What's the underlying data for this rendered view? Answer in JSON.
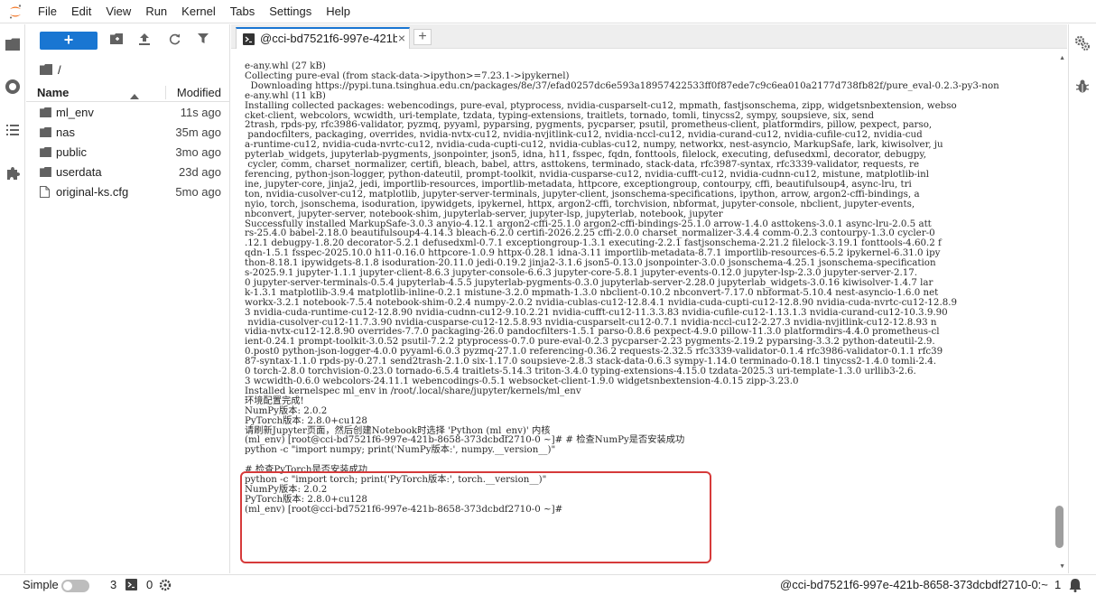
{
  "menubar": {
    "logo_icon": "jupyter-logo-icon",
    "items": [
      "File",
      "Edit",
      "View",
      "Run",
      "Kernel",
      "Tabs",
      "Settings",
      "Help"
    ]
  },
  "activitybar": {
    "icons": [
      "folder-icon",
      "running-icon",
      "toc-icon",
      "extension-icon"
    ]
  },
  "filebrowser": {
    "new_button_label": "+",
    "toolbar_icons": [
      "new-folder-icon",
      "upload-icon",
      "refresh-icon",
      "filter-icon"
    ],
    "breadcrumb": "/",
    "header_name": "Name",
    "header_modified": "Modified",
    "files": [
      {
        "name": "ml_env",
        "modified": "11s ago",
        "type": "folder"
      },
      {
        "name": "nas",
        "modified": "35m ago",
        "type": "folder"
      },
      {
        "name": "public",
        "modified": "3mo ago",
        "type": "folder"
      },
      {
        "name": "userdata",
        "modified": "23d ago",
        "type": "folder"
      },
      {
        "name": "original-ks.cfg",
        "modified": "5mo ago",
        "type": "file"
      }
    ]
  },
  "tabs": [
    {
      "label": "@cci-bd7521f6-997e-421b",
      "close": "×"
    }
  ],
  "tab_add": "+",
  "terminal": {
    "lines": [
      "e-any.whl (27 kB)",
      "Collecting pure-eval (from stack-data->ipython>=7.23.1->ipykernel)",
      "  Downloading https://pypi.tuna.tsinghua.edu.cn/packages/8e/37/efad0257dc6e593a18957422533ff0f87ede7c9c6ea010a2177d738fb82f/pure_eval-0.2.3-py3-non",
      "e-any.whl (11 kB)",
      "Installing collected packages: webencodings, pure-eval, ptyprocess, nvidia-cusparselt-cu12, mpmath, fastjsonschema, zipp, widgetsnbextension, webso",
      "cket-client, webcolors, wcwidth, uri-template, tzdata, typing-extensions, traitlets, tornado, tomli, tinycss2, sympy, soupsieve, six, send",
      "2trash, rpds-py, rfc3986-validator, pyzmq, pyyaml, pyparsing, pygments, pycparser, psutil, prometheus-client, platformdirs, pillow, pexpect, parso,",
      " pandocfilters, packaging, overrides, nvidia-nvtx-cu12, nvidia-nvjitlink-cu12, nvidia-nccl-cu12, nvidia-curand-cu12, nvidia-cufile-cu12, nvidia-cud",
      "a-runtime-cu12, nvidia-cuda-nvrtc-cu12, nvidia-cuda-cupti-cu12, nvidia-cublas-cu12, numpy, networkx, nest-asyncio, MarkupSafe, lark, kiwisolver, ju",
      "pyterlab_widgets, jupyterlab-pygments, jsonpointer, json5, idna, h11, fsspec, fqdn, fonttools, filelock, executing, defusedxml, decorator, debugpy,",
      " cycler, comm, charset_normalizer, certifi, bleach, babel, attrs, asttokens, terminado, stack-data, rfc3987-syntax, rfc3339-validator, requests, re",
      "ferencing, python-json-logger, python-dateutil, prompt-toolkit, nvidia-cusparse-cu12, nvidia-cufft-cu12, nvidia-cudnn-cu12, mistune, matplotlib-inl",
      "ine, jupyter-core, jinja2, jedi, importlib-resources, importlib-metadata, httpcore, exceptiongroup, contourpy, cffi, beautifulsoup4, async-lru, tri",
      "ton, nvidia-cusolver-cu12, matplotlib, jupyter-server-terminals, jupyter-client, jsonschema-specifications, ipython, arrow, argon2-cffi-bindings, a",
      "nyio, torch, jsonschema, isoduration, ipywidgets, ipykernel, httpx, argon2-cffi, torchvision, nbformat, jupyter-console, nbclient, jupyter-events,",
      "nbconvert, jupyter-server, notebook-shim, jupyterlab-server, jupyter-lsp, jupyterlab, notebook, jupyter",
      "Successfully installed MarkupSafe-3.0.3 anyio-4.12.1 argon2-cffi-25.1.0 argon2-cffi-bindings-25.1.0 arrow-1.4.0 asttokens-3.0.1 async-lru-2.0.5 att",
      "rs-25.4.0 babel-2.18.0 beautifulsoup4-4.14.3 bleach-6.2.0 certifi-2026.2.25 cffi-2.0.0 charset_normalizer-3.4.4 comm-0.2.3 contourpy-1.3.0 cycler-0",
      ".12.1 debugpy-1.8.20 decorator-5.2.1 defusedxml-0.7.1 exceptiongroup-1.3.1 executing-2.2.1 fastjsonschema-2.21.2 filelock-3.19.1 fonttools-4.60.2 f",
      "qdn-1.5.1 fsspec-2025.10.0 h11-0.16.0 httpcore-1.0.9 httpx-0.28.1 idna-3.11 importlib-metadata-8.7.1 importlib-resources-6.5.2 ipykernel-6.31.0 ipy",
      "thon-8.18.1 ipywidgets-8.1.8 isoduration-20.11.0 jedi-0.19.2 jinja2-3.1.6 json5-0.13.0 jsonpointer-3.0.0 jsonschema-4.25.1 jsonschema-specification",
      "s-2025.9.1 jupyter-1.1.1 jupyter-client-8.6.3 jupyter-console-6.6.3 jupyter-core-5.8.1 jupyter-events-0.12.0 jupyter-lsp-2.3.0 jupyter-server-2.17.",
      "0 jupyter-server-terminals-0.5.4 jupyterlab-4.5.5 jupyterlab-pygments-0.3.0 jupyterlab-server-2.28.0 jupyterlab_widgets-3.0.16 kiwisolver-1.4.7 lar",
      "k-1.3.1 matplotlib-3.9.4 matplotlib-inline-0.2.1 mistune-3.2.0 mpmath-1.3.0 nbclient-0.10.2 nbconvert-7.17.0 nbformat-5.10.4 nest-asyncio-1.6.0 net",
      "workx-3.2.1 notebook-7.5.4 notebook-shim-0.2.4 numpy-2.0.2 nvidia-cublas-cu12-12.8.4.1 nvidia-cuda-cupti-cu12-12.8.90 nvidia-cuda-nvrtc-cu12-12.8.9",
      "3 nvidia-cuda-runtime-cu12-12.8.90 nvidia-cudnn-cu12-9.10.2.21 nvidia-cufft-cu12-11.3.3.83 nvidia-cufile-cu12-1.13.1.3 nvidia-curand-cu12-10.3.9.90",
      " nvidia-cusolver-cu12-11.7.3.90 nvidia-cusparse-cu12-12.5.8.93 nvidia-cusparselt-cu12-0.7.1 nvidia-nccl-cu12-2.27.3 nvidia-nvjitlink-cu12-12.8.93 n",
      "vidia-nvtx-cu12-12.8.90 overrides-7.7.0 packaging-26.0 pandocfilters-1.5.1 parso-0.8.6 pexpect-4.9.0 pillow-11.3.0 platformdirs-4.4.0 prometheus-cl",
      "ient-0.24.1 prompt-toolkit-3.0.52 psutil-7.2.2 ptyprocess-0.7.0 pure-eval-0.2.3 pycparser-2.23 pygments-2.19.2 pyparsing-3.3.2 python-dateutil-2.9.",
      "0.post0 python-json-logger-4.0.0 pyyaml-6.0.3 pyzmq-27.1.0 referencing-0.36.2 requests-2.32.5 rfc3339-validator-0.1.4 rfc3986-validator-0.1.1 rfc39",
      "87-syntax-1.1.0 rpds-py-0.27.1 send2trash-2.1.0 six-1.17.0 soupsieve-2.8.3 stack-data-0.6.3 sympy-1.14.0 terminado-0.18.1 tinycss2-1.4.0 tomli-2.4.",
      "0 torch-2.8.0 torchvision-0.23.0 tornado-6.5.4 traitlets-5.14.3 triton-3.4.0 typing-extensions-4.15.0 tzdata-2025.3 uri-template-1.3.0 urllib3-2.6.",
      "3 wcwidth-0.6.0 webcolors-24.11.1 webencodings-0.5.1 websocket-client-1.9.0 widgetsnbextension-4.0.15 zipp-3.23.0",
      "Installed kernelspec ml_env in /root/.local/share/jupyter/kernels/ml_env",
      "环境配置完成!",
      "NumPy版本: 2.0.2",
      "PyTorch版本: 2.8.0+cu128",
      "请刷新Jupyter页面，然后创建Notebook时选择 'Python (ml_env)' 内核",
      "(ml_env) [root@cci-bd7521f6-997e-421b-8658-373dcbdf2710-0 ~]# # 检查NumPy是否安装成功",
      "python -c \"import numpy; print('NumPy版本:', numpy.__version__)\"",
      "",
      "# 检查PyTorch是否安装成功",
      "python -c \"import torch; print('PyTorch版本:', torch.__version__)\"",
      "NumPy版本: 2.0.2",
      "PyTorch版本: 2.8.0+cu128",
      "(ml_env) [root@cci-bd7521f6-997e-421b-8658-373dcbdf2710-0 ~]#"
    ],
    "highlight_color": "#d63a3a"
  },
  "rightbar": {
    "icons": [
      "settings-gears-icon",
      "debugger-bug-icon"
    ]
  },
  "statusbar": {
    "mode_label": "Simple",
    "terminals_count": "3",
    "kernels_count": "0",
    "terminal_name": "@cci-bd7521f6-997e-421b-8658-373dcbdf2710-0:~",
    "line_number": "1"
  }
}
